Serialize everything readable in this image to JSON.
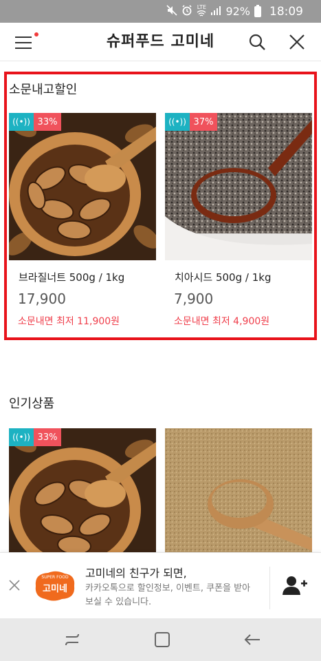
{
  "status": {
    "icons": [
      "mute-icon",
      "alarm-icon",
      "lte-wifi-icon",
      "signal-icon",
      "battery-icon"
    ],
    "lte_label": "LTE",
    "battery": "92%",
    "time": "18:09"
  },
  "header": {
    "title": "슈퍼푸드 고미네"
  },
  "discount_section": {
    "title": "소문내고할인",
    "outline_color": "#e8131b",
    "products": [
      {
        "discount": "33%",
        "name": "브라질너트 500g / 1kg",
        "price": "17,900",
        "sale_text": "소문내면 최저 11,900원",
        "image": "brazil-nut"
      },
      {
        "discount": "37%",
        "name": "치아시드 500g / 1kg",
        "price": "7,900",
        "sale_text": "소문내면 최저 4,900원",
        "image": "chia-seed"
      }
    ]
  },
  "popular_section": {
    "title": "인기상품",
    "products": [
      {
        "discount": "33%",
        "image": "brazil-nut"
      },
      {
        "image": "grain-powder"
      }
    ]
  },
  "kakao_banner": {
    "logo_small_text": "SUPER FOOD",
    "logo_text": "고미네",
    "title": "고미네의 친구가 되면,",
    "description": "카카오톡으로 할인정보, 이벤트, 쿠폰을 받아보실 수 있습니다."
  },
  "colors": {
    "badge_signal": "#1db2c2",
    "badge_discount": "#f0525c",
    "sale_text": "#ef3d4a",
    "logo_orange": "#f06a1d"
  },
  "nav": {
    "buttons": [
      "recent-apps",
      "home",
      "back"
    ]
  }
}
